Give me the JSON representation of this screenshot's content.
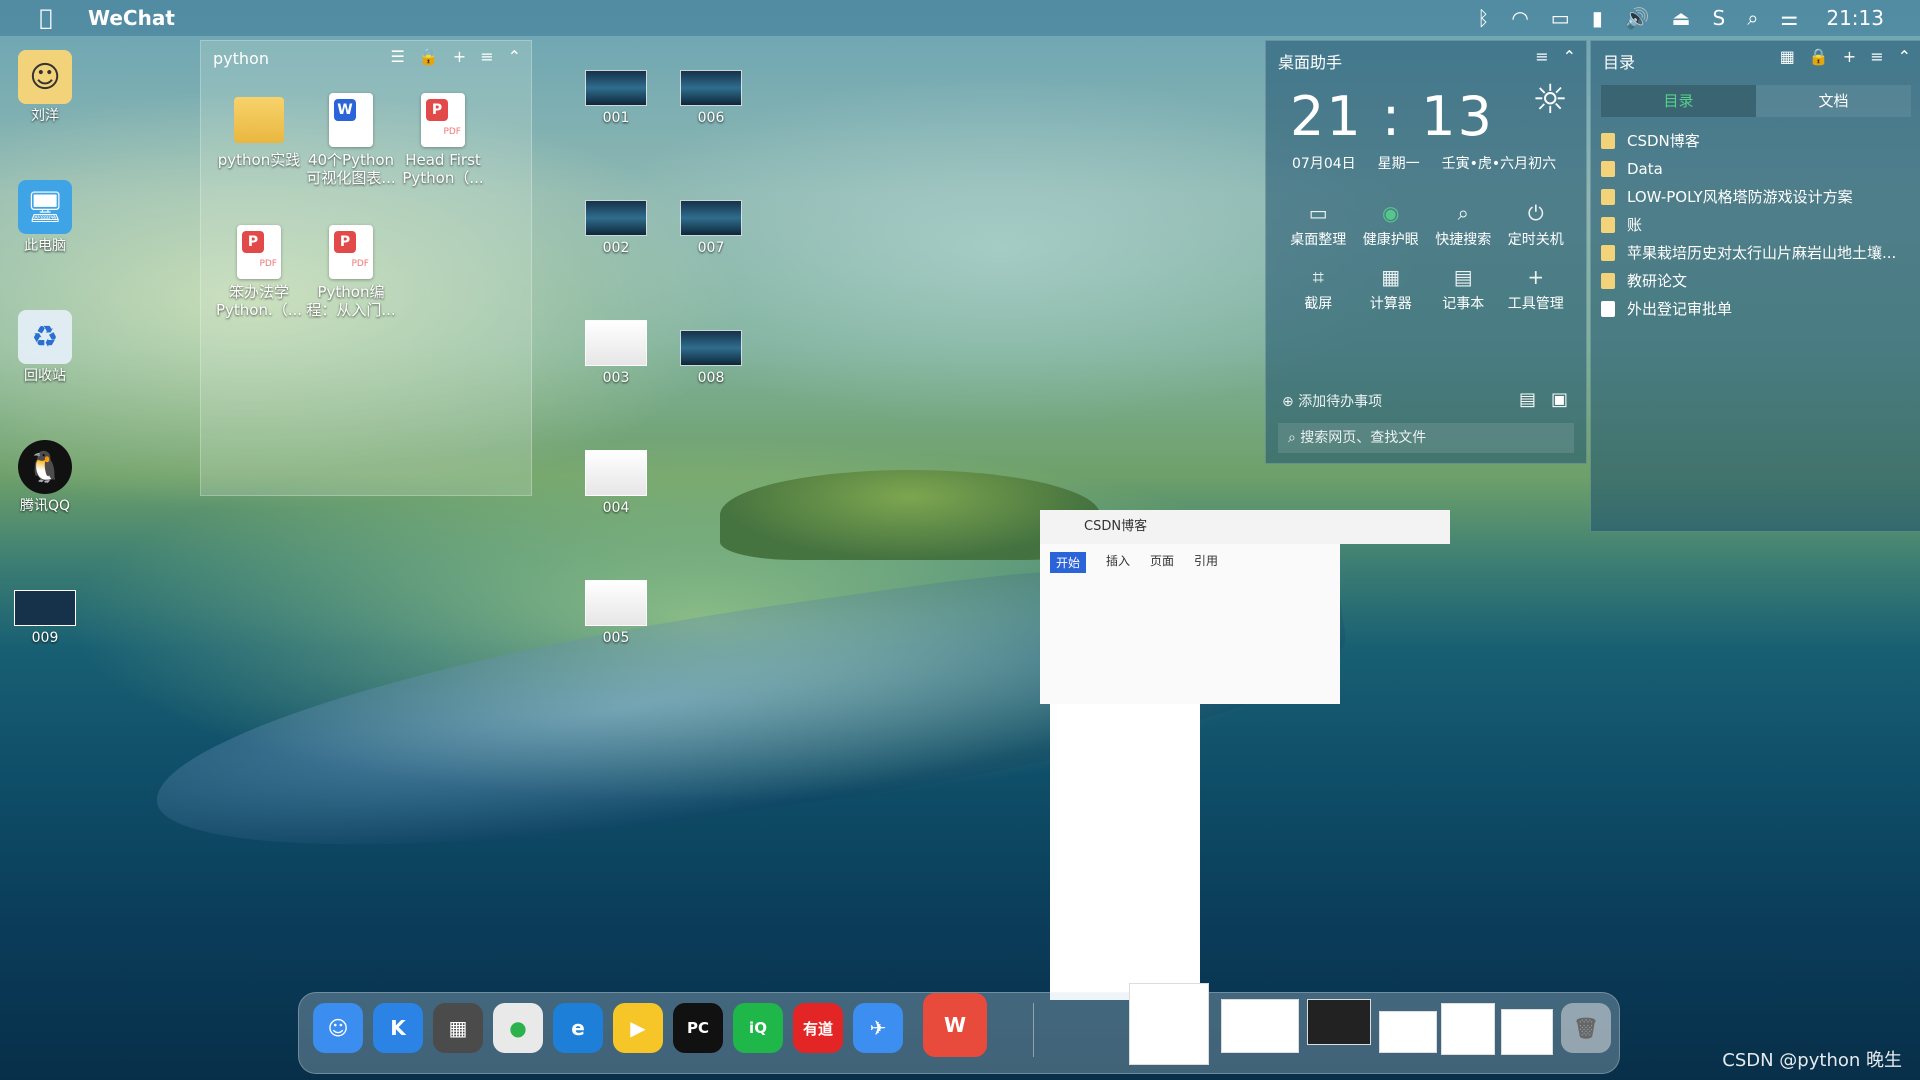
{
  "menubar": {
    "app_name": "WeChat",
    "time": "21:13",
    "icons": [
      "bluetooth-icon",
      "wifi-icon",
      "display-icon",
      "battery-icon",
      "volume-icon",
      "eject-icon",
      "app-s-icon",
      "search-icon",
      "control-center-icon"
    ]
  },
  "desktop_icons": [
    {
      "label": "刘洋",
      "icon": "user-folder-icon"
    },
    {
      "label": "此电脑",
      "icon": "computer-icon"
    },
    {
      "label": "回收站",
      "icon": "recycle-bin-icon"
    },
    {
      "label": "腾讯QQ",
      "icon": "qq-icon"
    },
    {
      "label": "009",
      "icon": "thumbnail-icon"
    }
  ],
  "python_panel": {
    "title": "python",
    "files": [
      {
        "line1": "python实践",
        "line2": "",
        "type": "folder"
      },
      {
        "line1": "40个Python",
        "line2": "可视化图表...",
        "type": "word",
        "badge": "W"
      },
      {
        "line1": "Head First",
        "line2": "Python（...",
        "type": "pdf",
        "badge": "P"
      },
      {
        "line1": "笨办法学",
        "line2": "Python.（...",
        "type": "pdf",
        "badge": "P"
      },
      {
        "line1": "Python编",
        "line2": "程：从入门...",
        "type": "pdf",
        "badge": "P"
      }
    ]
  },
  "thumbnails": [
    "001",
    "002",
    "003",
    "004",
    "005",
    "006",
    "007",
    "008"
  ],
  "assistant": {
    "title": "桌面助手",
    "time": "21 : 13",
    "date": "07月04日",
    "weekday": "星期一",
    "lunar": "壬寅•虎•六月初六",
    "buttons": [
      {
        "label": "桌面整理",
        "icon": "monitor-icon"
      },
      {
        "label": "健康护眼",
        "icon": "eye-icon"
      },
      {
        "label": "快捷搜索",
        "icon": "search-icon"
      },
      {
        "label": "定时关机",
        "icon": "power-icon"
      },
      {
        "label": "截屏",
        "icon": "crop-icon"
      },
      {
        "label": "计算器",
        "icon": "calculator-icon"
      },
      {
        "label": "记事本",
        "icon": "notepad-icon"
      },
      {
        "label": "工具管理",
        "icon": "plus-icon"
      }
    ],
    "todo": "添加待办事项",
    "search_placeholder": "搜索网页、查找文件"
  },
  "directory": {
    "title": "目录",
    "tabs": [
      "目录",
      "文档"
    ],
    "items": [
      {
        "label": "CSDN博客",
        "type": "folder"
      },
      {
        "label": "Data",
        "type": "folder"
      },
      {
        "label": "LOW-POLY风格塔防游戏设计方案",
        "type": "folder"
      },
      {
        "label": "账",
        "type": "folder"
      },
      {
        "label": "苹果栽培历史对太行山片麻岩山地土壤...",
        "type": "folder"
      },
      {
        "label": "教研论文",
        "type": "folder"
      },
      {
        "label": "外出登记审批单",
        "type": "file"
      }
    ]
  },
  "window": {
    "title": "CSDN博客",
    "tabs": [
      "开始",
      "插入",
      "页面",
      "引用"
    ]
  },
  "dock": {
    "apps": [
      {
        "name": "finder-icon",
        "glyph": "☺",
        "color": "#3b8df0"
      },
      {
        "name": "k-app-icon",
        "glyph": "K",
        "color": "#2b83e6"
      },
      {
        "name": "launchpad-icon",
        "glyph": "▦",
        "color": "#4b4b4b"
      },
      {
        "name": "wechat-icon",
        "glyph": "●",
        "color": "#e9e9e9"
      },
      {
        "name": "edge-icon",
        "glyph": "e",
        "color": "#1d7fd8"
      },
      {
        "name": "player-icon",
        "glyph": "▶",
        "color": "#f6c629"
      },
      {
        "name": "pycharm-icon",
        "glyph": "PC",
        "color": "#111111"
      },
      {
        "name": "iqiyi-icon",
        "glyph": "iQ",
        "color": "#1fb74a"
      },
      {
        "name": "youdao-icon",
        "glyph": "有道",
        "color": "#e32525"
      },
      {
        "name": "feishu-icon",
        "glyph": "✈",
        "color": "#3d8ef1"
      },
      {
        "name": "wps-icon",
        "glyph": "W",
        "color": "#e84b3c"
      }
    ],
    "trash": "trash-icon"
  },
  "watermark": "CSDN @python 晚生"
}
